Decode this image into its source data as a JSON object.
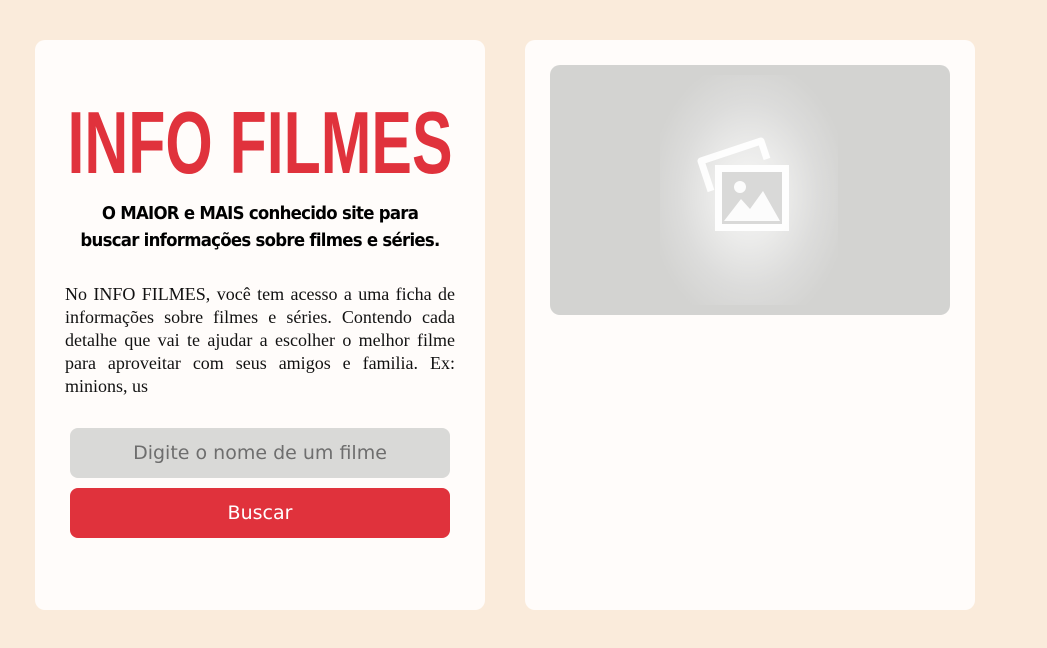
{
  "brand": {
    "logo_text": "INFO FILMES",
    "logo_color": "#e0323c"
  },
  "hero": {
    "tagline_line1": "O MAIOR e MAIS conhecido site para",
    "tagline_line2": "buscar informações sobre filmes e séries.",
    "description": "No INFO FILMES, você tem acesso a uma ficha de informações sobre filmes e séries. Contendo cada detalhe que vai te ajudar a escolher o melhor filme para aproveitar com seus amigos e familia. Ex: minions, us"
  },
  "search": {
    "placeholder": "Digite o nome de um filme",
    "value": "",
    "button_label": "Buscar"
  },
  "poster": {
    "icon": "image-placeholder-icon"
  },
  "colors": {
    "page_background": "#faebdb",
    "card_background": "#fffcfa",
    "accent": "#e0323c",
    "input_background": "#d9d9d7",
    "poster_placeholder": "#d3d3d1"
  }
}
